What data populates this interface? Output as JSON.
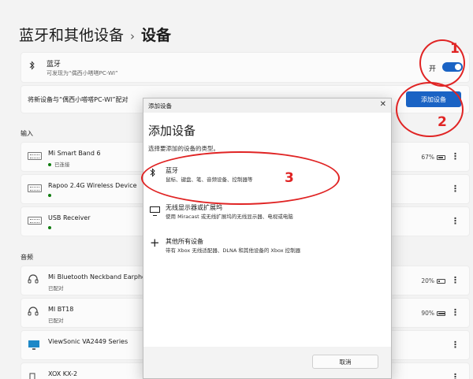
{
  "breadcrumb": {
    "parent": "蓝牙和其他设备",
    "separator": "›",
    "current": "设备"
  },
  "bluetooth": {
    "title": "蓝牙",
    "subtitle": "可发现为“偶西小嗒嗒PC-WI”",
    "toggle_label": "开",
    "toggle_on": true
  },
  "pair": {
    "text": "将新设备与“偶西小嗒嗒PC-WI”配对",
    "button_label": "添加设备"
  },
  "sections": {
    "input_label": "输入",
    "audio_label": "音频"
  },
  "input_devices": [
    {
      "name": "Mi Smart Band 6",
      "status": "已连接",
      "battery": "67%",
      "battery_level": 0.67
    },
    {
      "name": "Rapoo 2.4G Wireless Device",
      "status": "",
      "battery": ""
    },
    {
      "name": "USB Receiver",
      "status": "",
      "battery": ""
    }
  ],
  "audio_devices": [
    {
      "name": "Mi Bluetooth Neckband Earphones",
      "status": "已配对",
      "battery": "20%",
      "battery_level": 0.2
    },
    {
      "name": "MI BT18",
      "status": "已配对",
      "battery": "90%",
      "battery_level": 0.9
    },
    {
      "name": "ViewSonic VA2449 Series",
      "status": "",
      "battery": ""
    },
    {
      "name": "XOX KX-2",
      "status": "",
      "battery": ""
    }
  ],
  "dialog": {
    "titlebar": "添加设备",
    "close_glyph": "✕",
    "heading": "添加设备",
    "subheading": "选择要添加的设备的类型。",
    "options": [
      {
        "title": "蓝牙",
        "desc": "鼠标、键盘、笔、音频设备、控制器等"
      },
      {
        "title": "无线显示器或扩展坞",
        "desc": "使用 Miracast 或无线扩展坞的无线显示器、电视或电脑"
      },
      {
        "title": "其他所有设备",
        "desc": "带有 Xbox 无线适配器、DLNA 和其他设备的 Xbox 控制器"
      }
    ],
    "cancel_label": "取消"
  },
  "annotations": [
    "1",
    "2",
    "3"
  ],
  "icons": {
    "bluetooth": "bluetooth-icon",
    "more": "more-icon",
    "plus": "plus-icon"
  },
  "colors": {
    "accent": "#1a63c4",
    "annotation": "#e02424",
    "connected": "#107c10"
  }
}
